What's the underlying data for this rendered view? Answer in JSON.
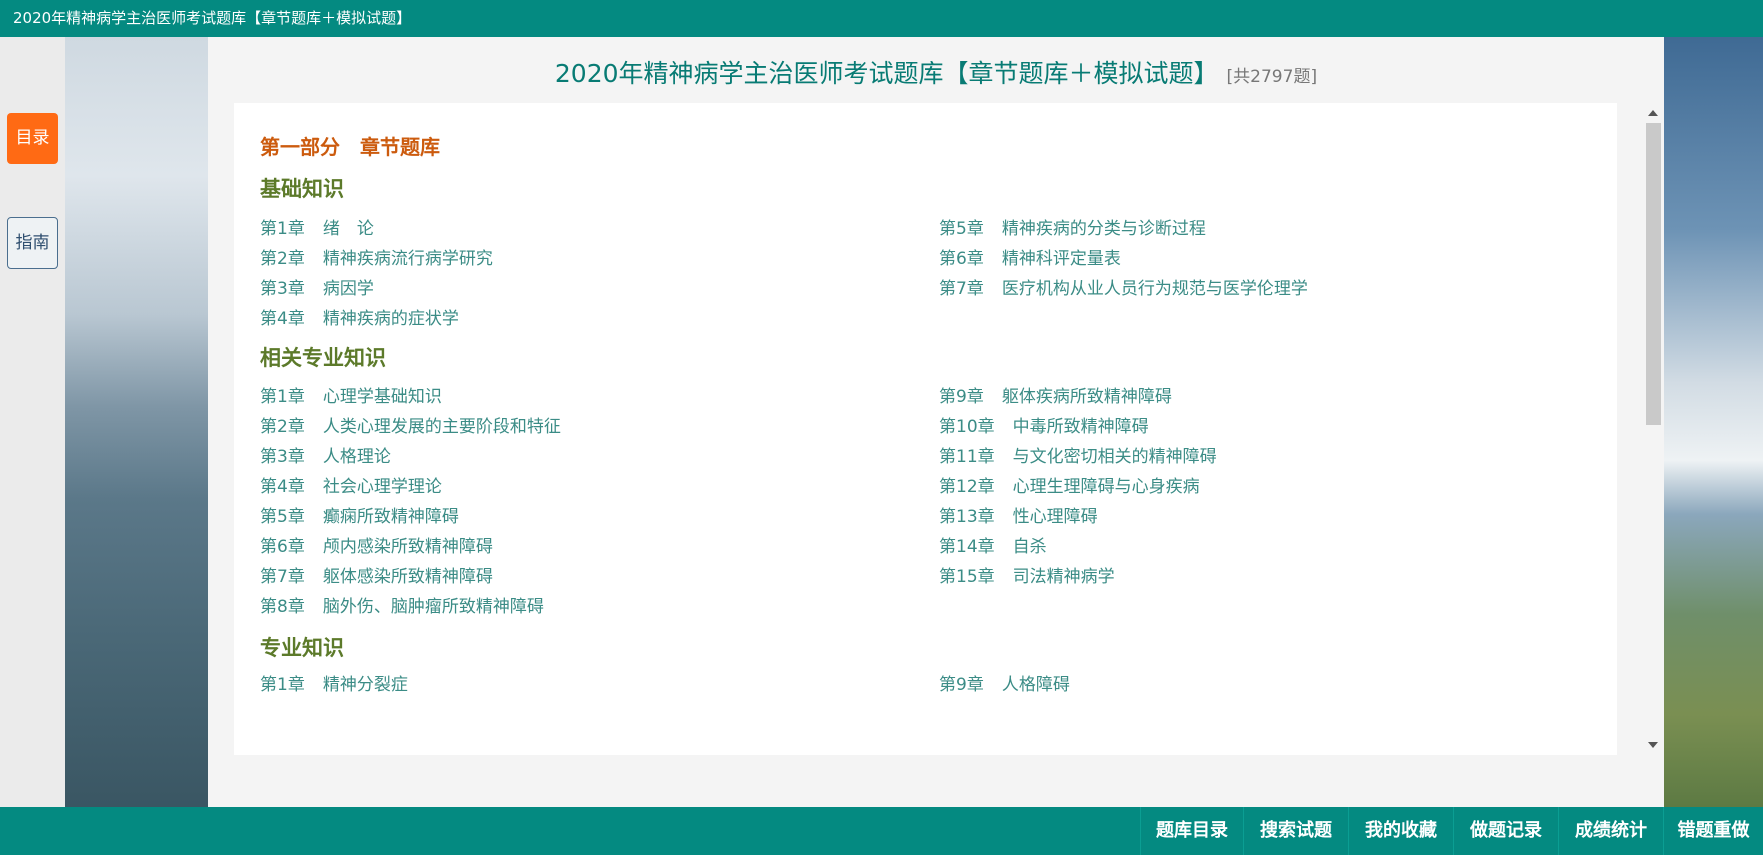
{
  "window_title": "2020年精神病学主治医师考试题库【章节题库＋模拟试题】",
  "sidebar": {
    "catalog_label": "目录",
    "guide_label": "指南"
  },
  "main": {
    "title": "2020年精神病学主治医师考试题库【章节题库＋模拟试题】",
    "count": "[共2797题]"
  },
  "part1": "第一部分　章节题库",
  "cat_basic": "基础知识",
  "cat_related": "相关专业知识",
  "cat_pro": "专业知识",
  "basic": [
    {
      "n": "第1章",
      "t": "绪　论"
    },
    {
      "n": "第2章",
      "t": "精神疾病流行病学研究"
    },
    {
      "n": "第3章",
      "t": "病因学"
    },
    {
      "n": "第4章",
      "t": "精神疾病的症状学"
    },
    {
      "n": "第5章",
      "t": "精神疾病的分类与诊断过程"
    },
    {
      "n": "第6章",
      "t": "精神科评定量表"
    },
    {
      "n": "第7章",
      "t": "医疗机构从业人员行为规范与医学伦理学"
    }
  ],
  "related": [
    {
      "n": "第1章",
      "t": "心理学基础知识"
    },
    {
      "n": "第2章",
      "t": "人类心理发展的主要阶段和特征"
    },
    {
      "n": "第3章",
      "t": "人格理论"
    },
    {
      "n": "第4章",
      "t": "社会心理学理论"
    },
    {
      "n": "第5章",
      "t": "癫痫所致精神障碍"
    },
    {
      "n": "第6章",
      "t": "颅内感染所致精神障碍"
    },
    {
      "n": "第7章",
      "t": "躯体感染所致精神障碍"
    },
    {
      "n": "第8章",
      "t": "脑外伤、脑肿瘤所致精神障碍"
    },
    {
      "n": "第9章",
      "t": "躯体疾病所致精神障碍"
    },
    {
      "n": "第10章",
      "t": "中毒所致精神障碍"
    },
    {
      "n": "第11章",
      "t": "与文化密切相关的精神障碍"
    },
    {
      "n": "第12章",
      "t": "心理生理障碍与心身疾病"
    },
    {
      "n": "第13章",
      "t": "性心理障碍"
    },
    {
      "n": "第14章",
      "t": "自杀"
    },
    {
      "n": "第15章",
      "t": "司法精神病学"
    }
  ],
  "pro": [
    {
      "n": "第1章",
      "t": "精神分裂症"
    },
    {
      "n": "第9章",
      "t": "人格障碍"
    }
  ],
  "bottom_nav": [
    "题库目录",
    "搜索试题",
    "我的收藏",
    "做题记录",
    "成绩统计",
    "错题重做"
  ],
  "colors": {
    "theme": "#048a81",
    "catalog_button": "#ff6a14",
    "part_heading": "#cc5b0e",
    "category_heading": "#5c7a2a",
    "chapter_link": "#3b8c86"
  }
}
